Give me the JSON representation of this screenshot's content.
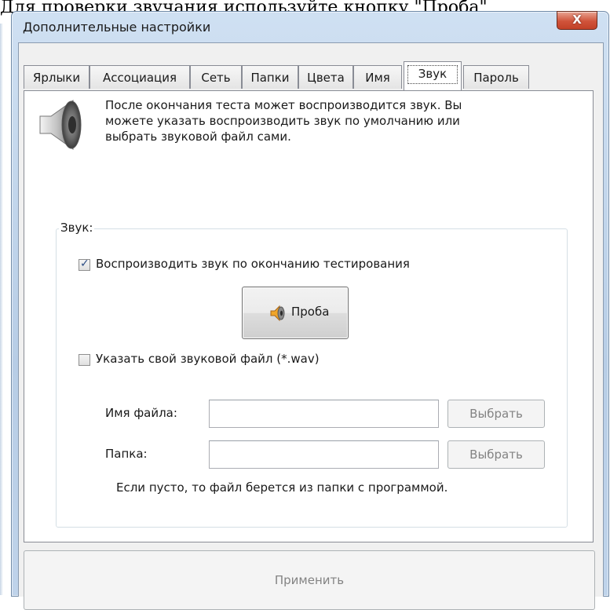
{
  "background_caption": "Для проверки звучания используйте кнопку \"Проба\"",
  "window": {
    "title": "Дополнительные настройки",
    "close_icon": "close-icon",
    "close_glyph": "X"
  },
  "tabs": [
    {
      "label": "Ярлыки"
    },
    {
      "label": "Ассоциация"
    },
    {
      "label": "Сеть"
    },
    {
      "label": "Папки"
    },
    {
      "label": "Цвета"
    },
    {
      "label": "Имя"
    },
    {
      "label": "Звук",
      "active": true
    },
    {
      "label": "Пароль"
    }
  ],
  "sound_page": {
    "icon": "speaker-icon",
    "info_text": "После окончания теста может воспроизводится звук. Вы можете указать воспроизводить звук по умолчанию или выбрать звуковой файл сами.",
    "group_label": "Звук:",
    "play_sound_checkbox": {
      "label": "Воспроизводить звук по окончанию тестирования",
      "checked": true
    },
    "test_button": {
      "label": "Проба",
      "icon": "speaker-icon"
    },
    "custom_file_checkbox": {
      "label": "Указать свой звуковой файл (*.wav)",
      "checked": false
    },
    "file_name": {
      "label": "Имя файла:",
      "value": "",
      "button": "Выбрать"
    },
    "folder": {
      "label": "Папка:",
      "value": "",
      "button": "Выбрать"
    },
    "hint": "Если пусто, то файл берется из папки с программой."
  },
  "apply_button": "Применить",
  "colors": {
    "close_button": "#c9472e",
    "disabled_text": "#838383",
    "checkmark": "#2d4e85"
  }
}
